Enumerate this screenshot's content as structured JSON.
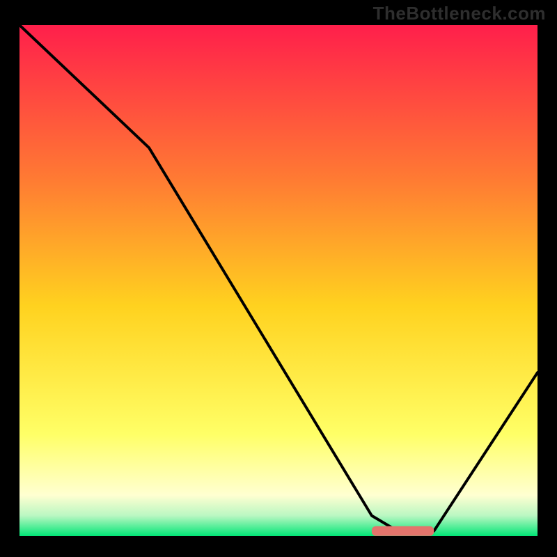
{
  "watermark": "TheBottleneck.com",
  "gradient": {
    "top": "#ff1f4b",
    "mid_upper": "#ff7a33",
    "mid": "#ffd21f",
    "mid_lower": "#ffff66",
    "lower_pale": "#ffffd1",
    "green_pale": "#baf7c2",
    "green": "#00e676"
  },
  "marker_color": "#e3746c",
  "curve_color": "#000000",
  "chart_data": {
    "type": "line",
    "title": "",
    "xlabel": "",
    "ylabel": "",
    "xlim": [
      0,
      100
    ],
    "ylim": [
      0,
      100
    ],
    "x": [
      0,
      25,
      68,
      73,
      80,
      100
    ],
    "values": [
      100,
      76,
      4,
      1,
      1,
      32
    ],
    "marker": {
      "x_start": 68,
      "x_end": 80,
      "y": 1
    },
    "notes": "V-shaped bottleneck curve; minimum (optimal) region ~68–80% on x-axis with value ~1%; y rises to 100% at x=0 and ~32% at x=100. Slight inflection around x≈25."
  }
}
